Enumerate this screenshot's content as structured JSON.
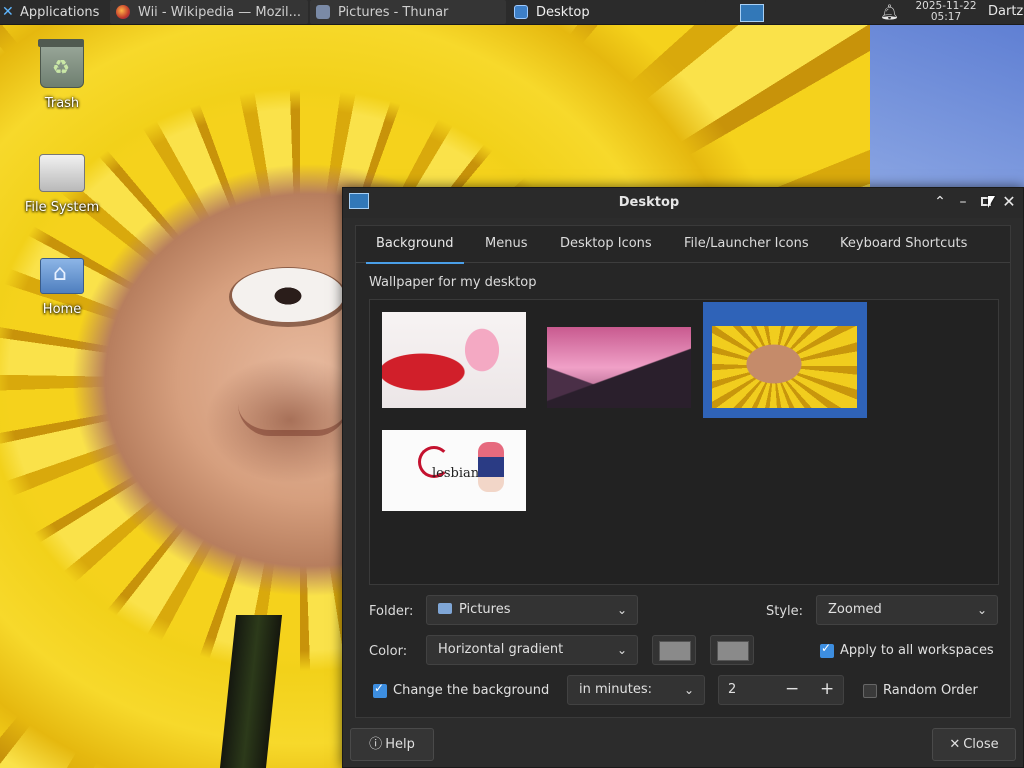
{
  "panel": {
    "apps_label": "Applications",
    "tasks": [
      {
        "label": "Wii - Wikipedia — Mozil...",
        "icon": "firefox-icon"
      },
      {
        "label": "Pictures - Thunar",
        "icon": "folder-icon"
      },
      {
        "label": "Desktop",
        "icon": "desktop-settings-icon"
      }
    ],
    "clock_date": "2025-11-22",
    "clock_time": "05:17",
    "user": "Dartz"
  },
  "desktop_icons": [
    {
      "label": "Trash"
    },
    {
      "label": "File System"
    },
    {
      "label": "Home"
    }
  ],
  "window": {
    "title": "Desktop",
    "tabs": [
      "Background",
      "Menus",
      "Desktop Icons",
      "File/Launcher Icons",
      "Keyboard Shortcuts"
    ],
    "active_tab": "Background",
    "wallpaper_label": "Wallpaper for my desktop",
    "thumbnail_text": "lesbian",
    "folder_label": "Folder:",
    "folder_value": "Pictures",
    "style_label": "Style:",
    "style_value": "Zoomed",
    "color_label": "Color:",
    "color_value": "Horizontal gradient",
    "apply_all_label": "Apply to all workspaces",
    "apply_all_checked": true,
    "change_bg_label": "Change the background",
    "change_bg_checked": true,
    "interval_value": "in minutes:",
    "interval_number": "2",
    "spin_minus": "−",
    "spin_plus": "+",
    "random_label": "Random Order",
    "random_checked": false,
    "help_label": "Help",
    "close_label": "Close"
  },
  "colors": {
    "accent": "#3d8ee0",
    "selection": "#2f63b8",
    "window_bg": "#2c2c2c"
  }
}
